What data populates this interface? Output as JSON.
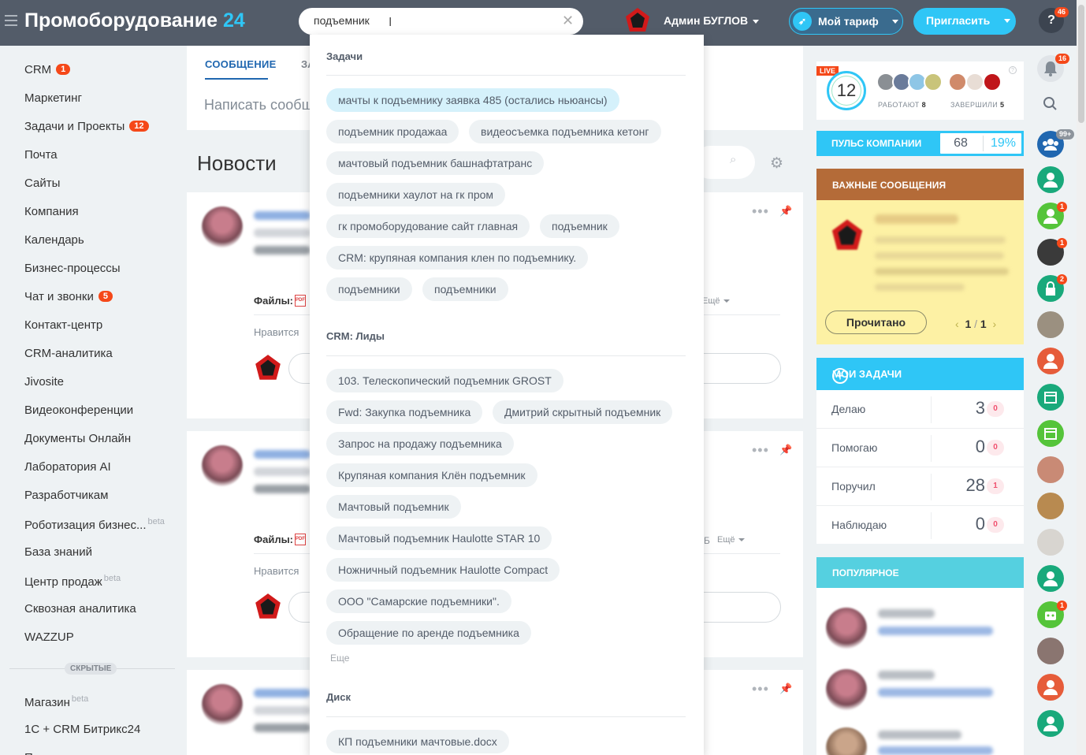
{
  "header": {
    "brand": "Промоборудование",
    "brand_num": "24",
    "search_value": "подъемник",
    "user_name": "Админ БУГЛОВ",
    "tariff_label": "Мой тариф",
    "invite_label": "Пригласить",
    "help_label": "?",
    "help_badge": "46"
  },
  "left_menu": {
    "items": [
      {
        "label": "CRM",
        "count": "1"
      },
      {
        "label": "Маркетинг"
      },
      {
        "label": "Задачи и Проекты",
        "count": "12"
      },
      {
        "label": "Почта"
      },
      {
        "label": "Сайты"
      },
      {
        "label": "Компания"
      },
      {
        "label": "Календарь"
      },
      {
        "label": "Бизнес-процессы"
      },
      {
        "label": "Чат и звонки",
        "count": "5"
      },
      {
        "label": "Контакт-центр"
      },
      {
        "label": "CRM-аналитика"
      },
      {
        "label": "Jivosite"
      },
      {
        "label": "Видеоконференции"
      },
      {
        "label": "Документы Онлайн"
      },
      {
        "label": "Лаборатория AI"
      },
      {
        "label": "Разработчикам"
      },
      {
        "label": "Роботизация бизнес...",
        "sup": "beta"
      },
      {
        "label": "База знаний"
      },
      {
        "label": "Центр продаж",
        "sup": "beta"
      },
      {
        "label": "Сквозная аналитика"
      },
      {
        "label": "WAZZUP"
      }
    ],
    "hidden_label": "СКРЫТЫЕ",
    "hidden_items": [
      {
        "label": "Магазин",
        "sup": "beta"
      },
      {
        "label": "1С + CRM Битрикс24"
      }
    ]
  },
  "feed": {
    "tab_message": "СООБЩЕНИЕ",
    "tab_task": "ЗА",
    "write_placeholder": "Написать сообщение",
    "news_title": "Новости",
    "files_label": "Файлы:",
    "like_label": "Нравится",
    "more_label": "Ещё",
    "post2_size": "Б"
  },
  "search_dropdown": {
    "tasks_title": "Задачи",
    "tasks": [
      "мачты к подъемнику заявка 485 (остались ньюансы)",
      "подъемник продажаа",
      "видеосъемка подъемника кетонг",
      "мачтовый подъемник башнафтатранс",
      "подъемники хаулот на гк пром",
      "гк промоборудование сайт главная",
      "подъемник",
      "CRM: крупяная компания клен по подъемнику.",
      "подъемники",
      "подъемники"
    ],
    "leads_title": "CRM: Лиды",
    "leads": [
      "103. Телескопический подъемник GROST",
      "Fwd: Закупка подъемника",
      "Дмитрий скрытный подъемник",
      "Запрос на продажу подъемника",
      "Крупяная компания Клён подъемник",
      "Мачтовый подъемник",
      "Мачтовый подъемник Haulotte STAR 10",
      "Ножничный подъемник Haulotte Compact",
      "ООО \"Самарские подъемники\".",
      "Обращение по аренде подъемника"
    ],
    "more_label": "Еще",
    "disk_title": "Диск",
    "disk": [
      "КП подъемники мачтовые.docx"
    ]
  },
  "right_panel": {
    "live_tag": "LIVE",
    "live_count": "12",
    "working_label": "РАБОТАЮТ",
    "working_count": "8",
    "finished_label": "ЗАВЕРШИЛИ",
    "finished_count": "5",
    "pulse_label": "ПУЛЬС КОМПАНИИ",
    "pulse_value": "68",
    "pulse_percent": "19%",
    "important_title": "ВАЖНЫЕ СООБЩЕНИЯ",
    "read_button": "Прочитано",
    "pager_current": "1",
    "pager_sep": "/",
    "pager_total": "1",
    "tasks_title": "МОИ ЗАДАЧИ",
    "tasks": [
      {
        "label": "Делаю",
        "count": "3",
        "badge": "0"
      },
      {
        "label": "Помогаю",
        "count": "0",
        "badge": "0"
      },
      {
        "label": "Поручил",
        "count": "28",
        "badge": "1"
      },
      {
        "label": "Наблюдаю",
        "count": "0",
        "badge": "0"
      }
    ],
    "popular_title": "ПОПУЛЯРНОЕ"
  },
  "right_strip": {
    "notifications_badge": "16",
    "group_badge": "99+",
    "badges": [
      "1",
      "1",
      "2",
      "1"
    ]
  },
  "colors": {
    "header_bg": "#535c69",
    "accent": "#2fc6f6",
    "badge_red": "#f54819",
    "important_head": "#b46b38",
    "important_bg": "#fdf1a4"
  }
}
